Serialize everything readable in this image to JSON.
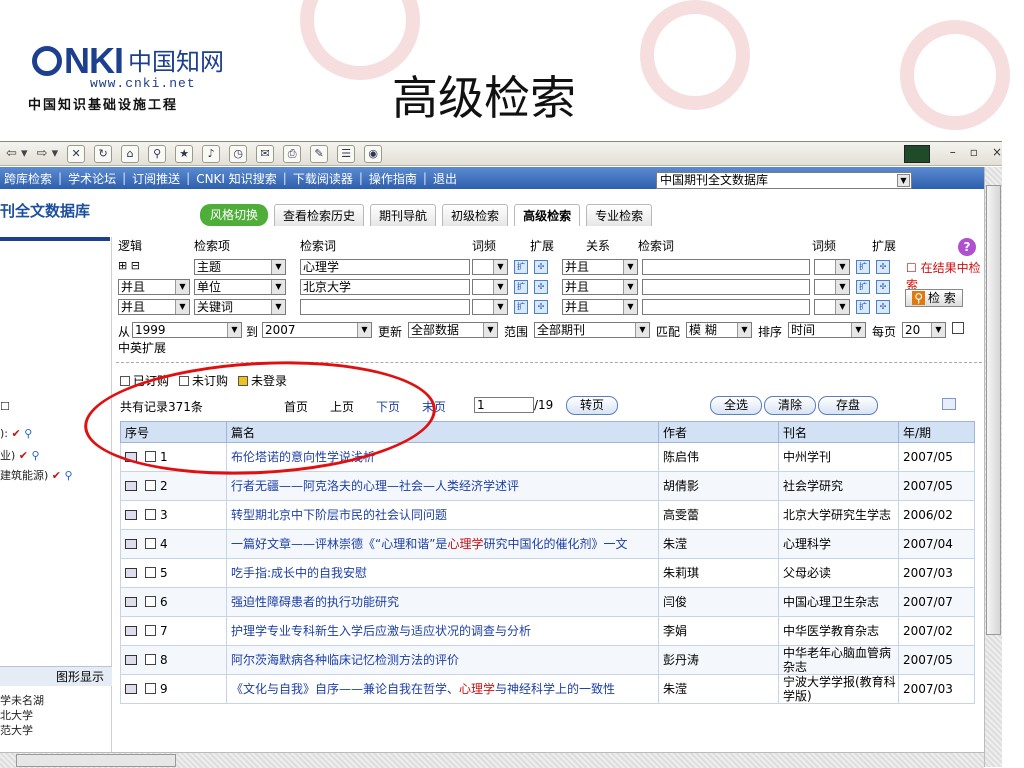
{
  "slide": {
    "title": "高级检索",
    "logo": {
      "brand": "NKI",
      "cn_name": "中国知网",
      "url": "www.cnki.net",
      "subtitle": "中国知识基础设施工程"
    }
  },
  "window": {
    "controls": [
      "–",
      "▫",
      "×"
    ],
    "toolbar_icons": [
      "back-icon",
      "forward-icon",
      "stop-icon",
      "refresh-icon",
      "home-icon",
      "search-icon",
      "favorites-icon",
      "media-icon",
      "history-icon",
      "mail-icon",
      "print-icon",
      "edit-icon",
      "discuss-icon",
      "messenger-icon"
    ]
  },
  "nav": {
    "links": [
      "跨库检索",
      "学术论坛",
      "订阅推送",
      "CNKI 知识搜索",
      "下载阅读器",
      "操作指南",
      "退出"
    ],
    "database_select": "中国期刊全文数据库"
  },
  "page": {
    "db_title": "刊全文数据库",
    "tabs": [
      "风格切换",
      "查看检索历史",
      "期刊导航",
      "初级检索",
      "高级检索",
      "专业检索"
    ],
    "active_tab": "高级检索"
  },
  "left_panel": {
    "items": [
      "):",
      "业)",
      "建筑能源)"
    ],
    "graph_button": "图形显示",
    "bottom_items": [
      "学未名湖",
      "北大学",
      "范大学"
    ]
  },
  "form": {
    "headers": [
      "逻辑",
      "检索项",
      "检索词",
      "词频",
      "扩展",
      "关系",
      "检索词",
      "词频",
      "扩展"
    ],
    "rows": [
      {
        "logic": "",
        "logic_icons": "⊞ ⊟",
        "field": "主题",
        "term": "心理学",
        "relation": "并且"
      },
      {
        "logic": "并且",
        "field": "单位",
        "term": "北京大学",
        "relation": "并且"
      },
      {
        "logic": "并且",
        "field": "关键词",
        "term": "",
        "relation": "并且"
      }
    ],
    "in_result_label": "在结果中检索",
    "search_button": "检 索",
    "date_from_label": "从",
    "date_from": "1999",
    "date_to_label": "到",
    "date_to": "2007",
    "update_label": "更新",
    "update_value": "全部数据",
    "range_label": "范围",
    "range_value": "全部期刊",
    "match_label": "匹配",
    "match_value": "模 糊",
    "sort_label": "排序",
    "sort_value": "时间",
    "per_page_label": "每页",
    "per_page_value": "20",
    "cn_en_expand": "中英扩展"
  },
  "legend": [
    "已订购",
    "未订购",
    "未登录"
  ],
  "pager": {
    "total": "共有记录371条",
    "first": "首页",
    "prev": "上页",
    "next": "下页",
    "last": "末页",
    "page": "1",
    "page_total": "/19",
    "go": "转页",
    "select_all": "全选",
    "clear": "清除",
    "save": "存盘"
  },
  "table": {
    "headers": [
      "序号",
      "篇名",
      "作者",
      "刊名",
      "年/期"
    ],
    "rows": [
      {
        "no": "1",
        "title": "布伦塔诺的意向性学说浅析",
        "author": "陈启伟",
        "journal": "中州学刊",
        "issue": "2007/05"
      },
      {
        "no": "2",
        "title": "行者无疆——阿克洛夫的心理—社会—人类经济学述评",
        "author": "胡倩影",
        "journal": "社会学研究",
        "issue": "2007/05"
      },
      {
        "no": "3",
        "title": "转型期北京中下阶层市民的社会认同问题",
        "author": "高雯蕾",
        "journal": "北京大学研究生学志",
        "issue": "2006/02"
      },
      {
        "no": "4",
        "title_pre": "一篇好文章——评林崇德《“心理和谐”是",
        "title_hl": "心理学",
        "title_post": "研究中国化的催化剂》一文",
        "author": "朱滢",
        "journal": "心理科学",
        "issue": "2007/04"
      },
      {
        "no": "5",
        "title": "吃手指:成长中的自我安慰",
        "author": "朱莉琪",
        "journal": "父母必读",
        "issue": "2007/03"
      },
      {
        "no": "6",
        "title": "强迫性障碍患者的执行功能研究",
        "author": "闫俊",
        "journal": "中国心理卫生杂志",
        "issue": "2007/07"
      },
      {
        "no": "7",
        "title": "护理学专业专科新生入学后应激与适应状况的调查与分析",
        "author": "李娟",
        "journal": "中华医学教育杂志",
        "issue": "2007/02"
      },
      {
        "no": "8",
        "title": "阿尔茨海默病各种临床记忆检测方法的评价",
        "author": "彭丹涛",
        "journal": "中华老年心脑血管病杂志",
        "issue": "2007/05"
      },
      {
        "no": "9",
        "title_pre": "《文化与自我》自序——兼论自我在哲学、",
        "title_hl": "心理学",
        "title_post": "与神经科学上的一致性",
        "author": "朱滢",
        "journal": "宁波大学学报(教育科学版)",
        "issue": "2007/03"
      }
    ]
  }
}
